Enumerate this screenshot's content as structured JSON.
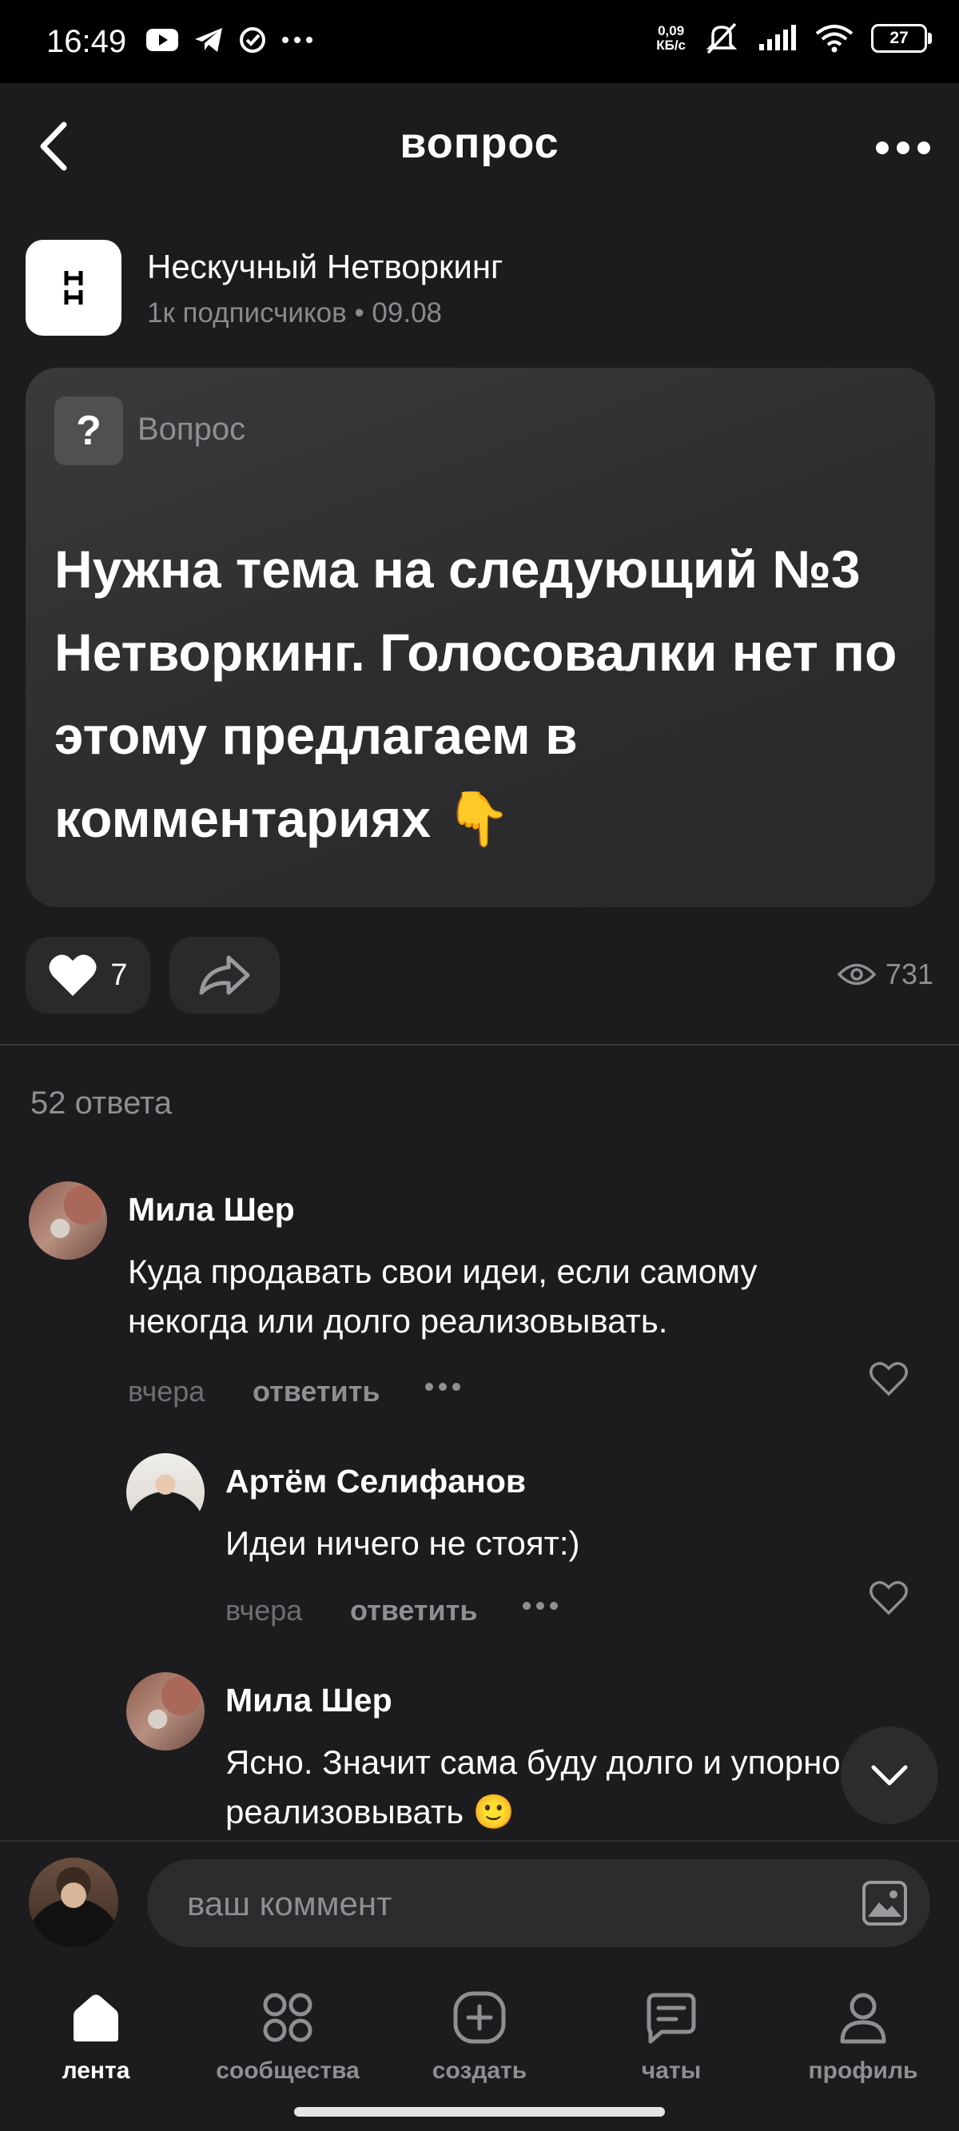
{
  "status_bar": {
    "time": "16:49",
    "speed_value": "0,09",
    "speed_unit": "КБ/с",
    "battery": "27"
  },
  "header": {
    "title": "вопрос"
  },
  "author": {
    "logo_text": "Н\nН",
    "name": "Нескучный Нетворкинг",
    "meta": "1к подписчиков • 09.08"
  },
  "question": {
    "label": "Вопрос",
    "icon_glyph": "?",
    "text": "Нужна тема на следующий №3 Нетворкинг. Голосовалки нет по этому предлагаем в комментариях 👇"
  },
  "actions": {
    "likes": "7",
    "views": "731"
  },
  "answers_count": "52 ответа",
  "comments": [
    {
      "author": "Мила Шер",
      "text": "Куда продавать свои идеи, если самому некогда или долго реализовывать.",
      "time": "вчера",
      "reply_label": "ответить"
    },
    {
      "author": "Артём Селифанов",
      "text": "Идеи ничего не стоят:)",
      "time": "вчера",
      "reply_label": "ответить"
    },
    {
      "author": "Мила Шер",
      "text": "Ясно. Значит сама буду долго и упорно реализовывать 🙂"
    }
  ],
  "comment_input": {
    "placeholder": "ваш коммент"
  },
  "nav": {
    "items": [
      {
        "label": "лента",
        "icon": "home-icon",
        "active": true
      },
      {
        "label": "сообщества",
        "icon": "grid-icon"
      },
      {
        "label": "создать",
        "icon": "plus-square-icon"
      },
      {
        "label": "чаты",
        "icon": "chat-icon"
      },
      {
        "label": "профиль",
        "icon": "person-icon"
      }
    ]
  },
  "colors": {
    "background": "#1c1c1e",
    "card": "#2c2c2e",
    "muted": "#8e8e93"
  }
}
